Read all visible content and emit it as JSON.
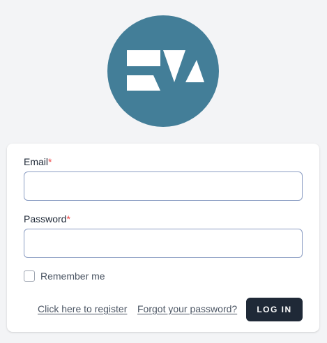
{
  "brand": {
    "logo_icon": "eva-logo-icon",
    "logo_color": "#437e98",
    "logo_letters": "EVA"
  },
  "form": {
    "email": {
      "label": "Email",
      "required_marker": "*",
      "value": "",
      "placeholder": ""
    },
    "password": {
      "label": "Password",
      "required_marker": "*",
      "value": "",
      "placeholder": ""
    },
    "remember": {
      "label": "Remember me",
      "checked": false
    },
    "register_link": "Click here to register",
    "forgot_link": "Forgot your password?",
    "submit_label": "LOG IN"
  },
  "colors": {
    "background": "#f3f4f6",
    "card": "#ffffff",
    "accent": "#1f2937",
    "required": "#ef4444",
    "input_border": "#8b9dc3"
  }
}
